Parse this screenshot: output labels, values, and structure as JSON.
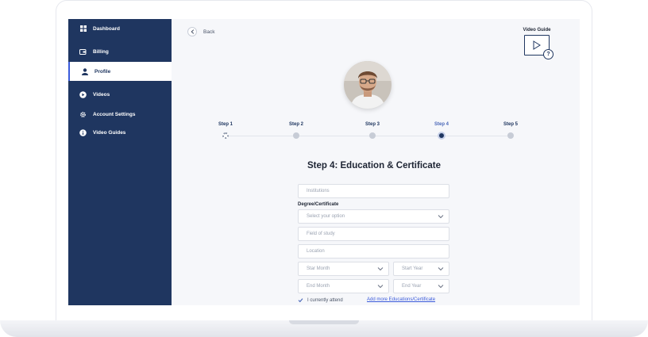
{
  "sidebar": {
    "items": [
      {
        "label": "Dashboard",
        "icon": "grid-icon"
      },
      {
        "label": "Billing",
        "icon": "wallet-icon"
      },
      {
        "label": "Profile",
        "icon": "user-icon"
      },
      {
        "label": "Videos",
        "icon": "play-circle-icon"
      },
      {
        "label": "Account Settings",
        "icon": "gear-icon"
      },
      {
        "label": "Video Guides",
        "icon": "info-circle-icon"
      }
    ],
    "active": "Profile"
  },
  "header": {
    "back_label": "Back",
    "video_guide_label": "Video Guide",
    "video_guide_help": "?"
  },
  "steps": [
    {
      "label": "Step 1",
      "state": "done"
    },
    {
      "label": "Step 2",
      "state": "todo"
    },
    {
      "label": "Step 3",
      "state": "todo"
    },
    {
      "label": "Step 4",
      "state": "current"
    },
    {
      "label": "Step 5",
      "state": "todo"
    }
  ],
  "form": {
    "title": "Step 4: Education & Certificate",
    "institutions_placeholder": "Institutions",
    "degree_label": "Degree/Certificate",
    "degree_placeholder": "Select your option",
    "field_of_study_placeholder": "Field of study",
    "location_placeholder": "Location",
    "start_month_placeholder": "Star Month",
    "start_year_placeholder": "Start Year",
    "end_month_placeholder": "End Month",
    "end_year_placeholder": "End Year",
    "currently_attend_label": "I currently attend",
    "add_more_label": "Add more Educations/Certificate"
  },
  "colors": {
    "sidebar_bg": "#1f3660",
    "accent": "#3b5bdb",
    "page_bg": "#f6f7fa"
  }
}
